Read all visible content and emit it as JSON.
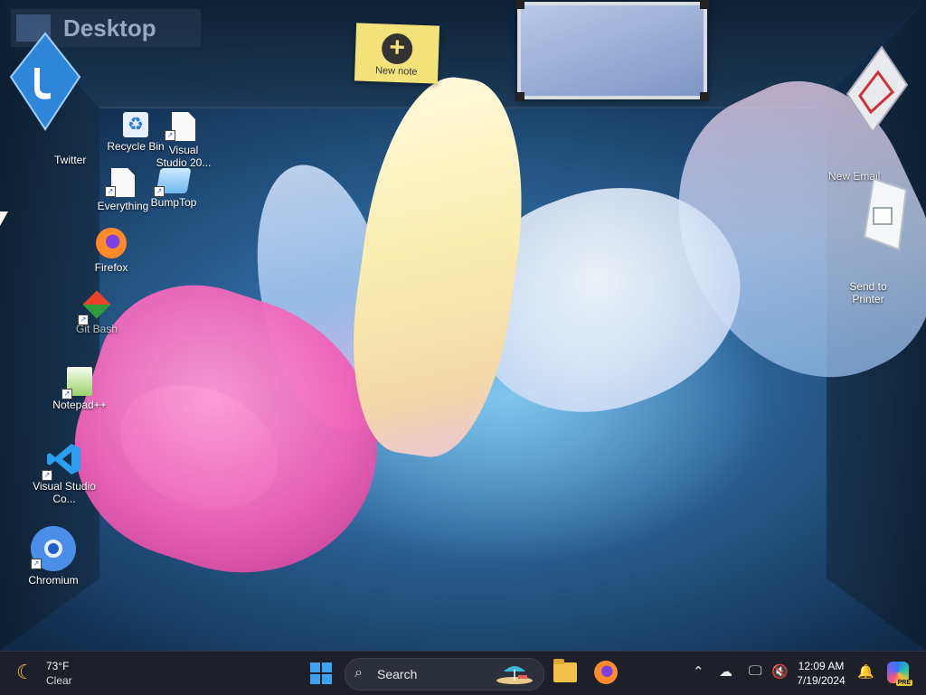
{
  "desktop": {
    "title": "Desktop",
    "note": {
      "label": "New note"
    },
    "icons": {
      "twitter": "Twitter",
      "recycle_bin": "Recycle Bin",
      "visual_studio_20": "Visual Studio 20...",
      "everything": "Everything",
      "bumptop": "BumpTop",
      "firefox": "Firefox",
      "git_bash": "Git Bash",
      "notepadpp": "Notepad++",
      "vscode": "Visual Studio Co...",
      "chromium": "Chromium",
      "new_email": "New Email",
      "send_to_printer": "Send to Printer"
    }
  },
  "taskbar": {
    "weather": {
      "temp": "73°F",
      "desc": "Clear",
      "icon": "moon-icon"
    },
    "search_label": "Search",
    "clock": {
      "time": "12:09 AM",
      "date": "7/19/2024"
    },
    "accent": "#3ea2f0"
  }
}
